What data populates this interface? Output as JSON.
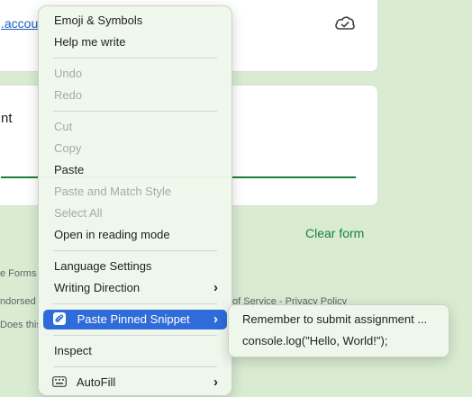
{
  "background": {
    "link_partial": ".accou",
    "field_partial": "nt",
    "clear_form": "Clear form",
    "footer_forms": "e Forms",
    "footer_endorsed": "ndorsed l",
    "footer_terms": "of Service - Privacy Policy",
    "footer_does": "Does this",
    "accent_color": "#188038"
  },
  "context_menu": {
    "items": [
      {
        "label": "Emoji & Symbols"
      },
      {
        "label": "Help me write"
      },
      {
        "label": "Undo"
      },
      {
        "label": "Redo"
      },
      {
        "label": "Cut"
      },
      {
        "label": "Copy"
      },
      {
        "label": "Paste"
      },
      {
        "label": "Paste and Match Style"
      },
      {
        "label": "Select All"
      },
      {
        "label": "Open in reading mode"
      },
      {
        "label": "Language Settings"
      },
      {
        "label": "Writing Direction"
      },
      {
        "label": "Paste Pinned Snippet"
      },
      {
        "label": "Inspect"
      },
      {
        "label": "AutoFill"
      }
    ],
    "disabled_items": [
      "Undo",
      "Redo",
      "Cut",
      "Copy",
      "Paste and Match Style",
      "Select All"
    ],
    "highlight_color": "#2f6cd9"
  },
  "submenu": {
    "items": [
      {
        "label": "Remember to submit assignment ..."
      },
      {
        "label": "console.log(\"Hello, World!\");"
      }
    ]
  }
}
